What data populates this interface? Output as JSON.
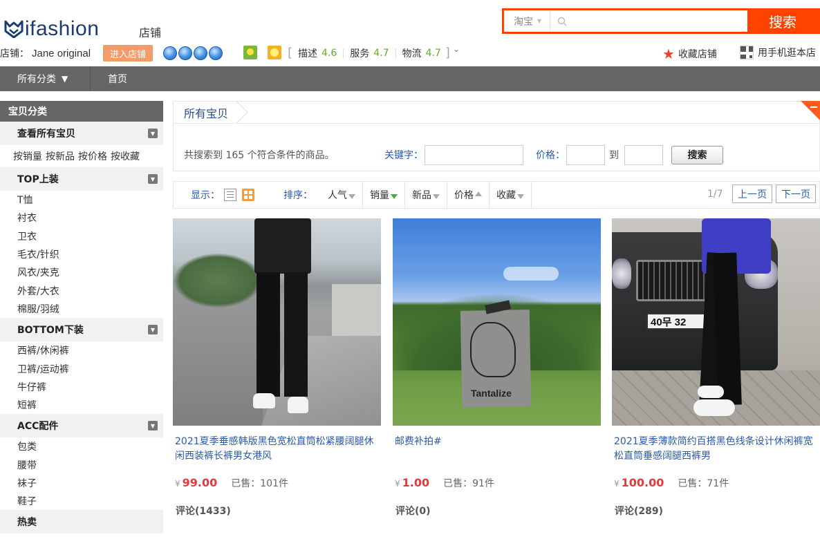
{
  "header": {
    "logo_text": "ifashion",
    "shop_word": "店铺",
    "search": {
      "scope": "淘宝",
      "placeholder": "",
      "button": "搜索"
    },
    "shop_label": "店铺：",
    "shop_name": "Jane original",
    "enter_shop": "进入店铺",
    "ratings": [
      {
        "label": "描述",
        "score": "4.6"
      },
      {
        "label": "服务",
        "score": "4.7"
      },
      {
        "label": "物流",
        "score": "4.7"
      }
    ],
    "rating_bracket_open": "[",
    "rating_bracket_close": "]",
    "favorite_shop": "收藏店铺",
    "mobile_shop": "用手机逛本店"
  },
  "nav": {
    "all_categories": "所有分类",
    "home": "首页"
  },
  "sidebar": {
    "title": "宝贝分类",
    "view_all": "查看所有宝贝",
    "view_all_links": [
      "按销量",
      "按新品",
      "按价格",
      "按收藏"
    ],
    "groups": [
      {
        "title": "TOP上装",
        "items": [
          "T恤",
          "衬衣",
          "卫衣",
          "毛衣/针织",
          "风衣/夹克",
          "外套/大衣",
          "棉服/羽绒"
        ]
      },
      {
        "title": "BOTTOM下装",
        "items": [
          "西裤/休闲裤",
          "卫裤/运动裤",
          "牛仔裤",
          "短裤"
        ]
      },
      {
        "title": "ACC配件",
        "items": [
          "包类",
          "腰带",
          "袜子",
          "鞋子"
        ]
      }
    ],
    "hot": "热卖"
  },
  "main": {
    "tab_title": "所有宝贝",
    "result_count": "共搜索到 165 个符合条件的商品。",
    "keyword_label": "关键字：",
    "keyword_value": "",
    "price_label": "价格：",
    "price_to": "到",
    "price_min": "",
    "price_max": "",
    "search_button": "搜索",
    "display_label": "显示：",
    "sort_label": "排序：",
    "sort_options": [
      "人气",
      "销量",
      "新品",
      "价格",
      "收藏"
    ],
    "page_info": "1/7",
    "prev_page": "上一页",
    "next_page": "下一页"
  },
  "products": [
    {
      "title": "2021夏季垂感韩版黑色宽松直筒松紧腰阔腿休闲西装裤长裤男女港风",
      "currency": "¥",
      "price": "99.00",
      "sold": "已售：101件",
      "comments": "评论(1433)"
    },
    {
      "title": "邮费补拍#",
      "currency": "¥",
      "price": "1.00",
      "sold": "已售：91件",
      "comments": "评论(0)",
      "image_text": "Tantalize"
    },
    {
      "title": "2021夏季薄款简约百搭黑色线条设计休闲裤宽松直筒垂感阔腿西裤男",
      "currency": "¥",
      "price": "100.00",
      "sold": "已售：71件",
      "comments": "评论(289)",
      "image_text": "40무 32"
    }
  ],
  "colors": {
    "accent": "#ff4200",
    "link": "#2b5aa8",
    "price": "#e4393c",
    "nav_bg": "#666666"
  }
}
